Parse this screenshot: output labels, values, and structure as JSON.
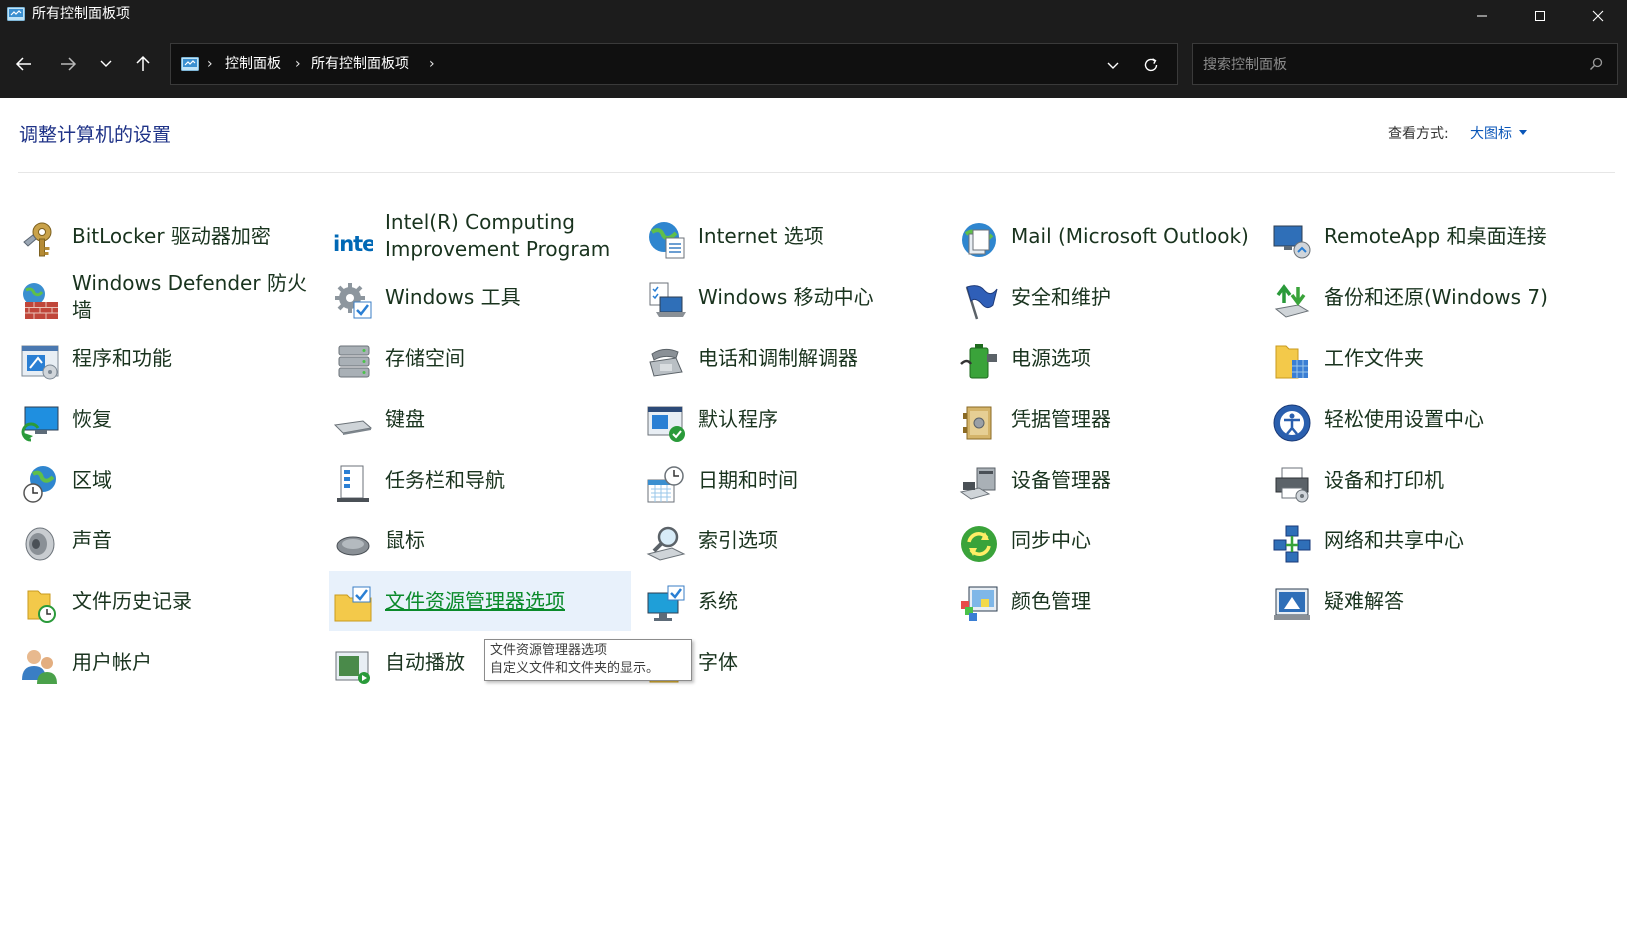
{
  "window": {
    "title": "所有控制面板项"
  },
  "address": {
    "crumbs": [
      "控制面板",
      "所有控制面板项"
    ]
  },
  "search": {
    "placeholder": "搜索控制面板"
  },
  "page": {
    "title": "调整计算机的设置",
    "view_by_label": "查看方式:",
    "view_by_value": "大图标"
  },
  "items": [
    {
      "label": "BitLocker 驱动器加密",
      "icon": "bitlocker-key-icon"
    },
    {
      "label": "Intel(R) Computing Improvement Program",
      "icon": "intel-logo-icon"
    },
    {
      "label": "Internet 选项",
      "icon": "globe-document-icon"
    },
    {
      "label": "Mail (Microsoft Outlook)",
      "icon": "mail-globe-icon"
    },
    {
      "label": "RemoteApp 和桌面连接",
      "icon": "remote-desktop-icon"
    },
    {
      "label": "Windows Defender 防火墙",
      "icon": "firewall-wall-icon"
    },
    {
      "label": "Windows 工具",
      "icon": "gear-tools-icon"
    },
    {
      "label": "Windows 移动中心",
      "icon": "laptop-checklist-icon"
    },
    {
      "label": "安全和维护",
      "icon": "flag-icon"
    },
    {
      "label": "备份和还原(Windows 7)",
      "icon": "backup-arrows-icon"
    },
    {
      "label": "程序和功能",
      "icon": "programs-window-icon"
    },
    {
      "label": "存储空间",
      "icon": "storage-drives-icon"
    },
    {
      "label": "电话和调制解调器",
      "icon": "telephone-icon"
    },
    {
      "label": "电源选项",
      "icon": "battery-plug-icon"
    },
    {
      "label": "工作文件夹",
      "icon": "work-folder-icon"
    },
    {
      "label": "恢复",
      "icon": "monitor-restore-icon"
    },
    {
      "label": "键盘",
      "icon": "keyboard-icon"
    },
    {
      "label": "默认程序",
      "icon": "default-programs-icon"
    },
    {
      "label": "凭据管理器",
      "icon": "credential-safe-icon"
    },
    {
      "label": "轻松使用设置中心",
      "icon": "ease-of-access-icon"
    },
    {
      "label": "区域",
      "icon": "globe-clock-icon"
    },
    {
      "label": "任务栏和导航",
      "icon": "taskbar-icon"
    },
    {
      "label": "日期和时间",
      "icon": "calendar-clock-icon"
    },
    {
      "label": "设备管理器",
      "icon": "device-manager-icon"
    },
    {
      "label": "设备和打印机",
      "icon": "printer-icon"
    },
    {
      "label": "声音",
      "icon": "speaker-icon"
    },
    {
      "label": "鼠标",
      "icon": "mouse-icon"
    },
    {
      "label": "索引选项",
      "icon": "magnifier-index-icon"
    },
    {
      "label": "同步中心",
      "icon": "sync-arrows-icon"
    },
    {
      "label": "网络和共享中心",
      "icon": "network-icon"
    },
    {
      "label": "文件历史记录",
      "icon": "folder-clock-icon"
    },
    {
      "label": "文件资源管理器选项",
      "icon": "folder-check-icon"
    },
    {
      "label": "系统",
      "icon": "monitor-check-icon"
    },
    {
      "label": "颜色管理",
      "icon": "color-palette-icon"
    },
    {
      "label": "疑难解答",
      "icon": "troubleshoot-monitor-icon"
    },
    {
      "label": "用户帐户",
      "icon": "users-icon"
    },
    {
      "label": "自动播放",
      "icon": "autoplay-icon"
    },
    {
      "label": "字体",
      "icon": "font-letter-icon"
    }
  ],
  "tooltip": {
    "title": "文件资源管理器选项",
    "description": "自定义文件和文件夹的显示。"
  },
  "colors": {
    "chrome": "#1c1c1c",
    "title_link": "#1e3287",
    "item_text": "#19331e",
    "hover_bg": "#e8f1fb",
    "hover_text": "#0a8a2a",
    "accent": "#0a56b8"
  }
}
